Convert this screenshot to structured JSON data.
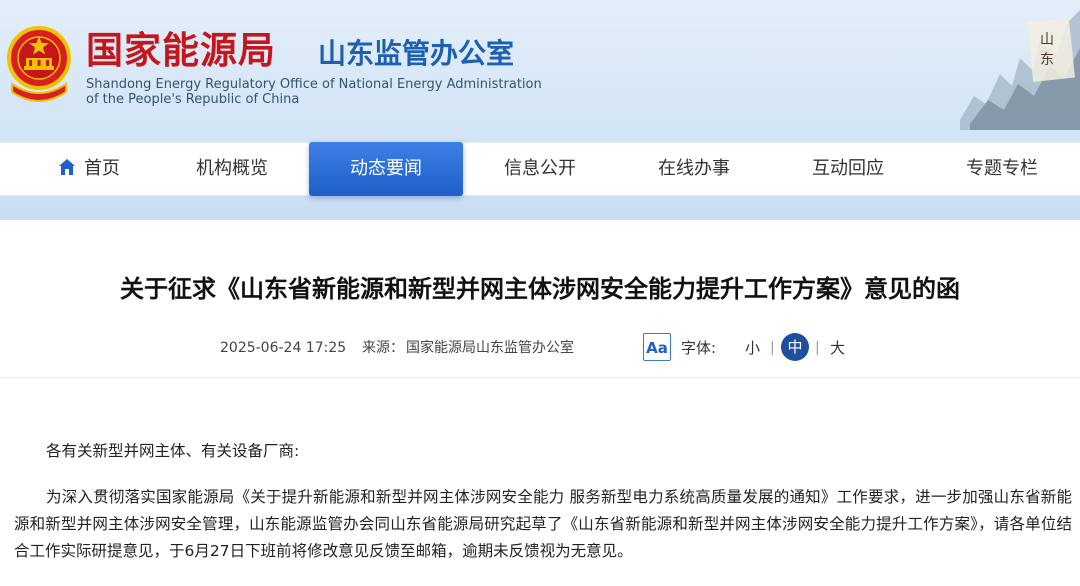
{
  "header": {
    "org_name_cn": "国家能源局",
    "office_name_cn": "山东监管办公室",
    "org_name_en_line1": "Shandong Energy Regulatory Office of National Energy Administration",
    "org_name_en_line2": "of the People's Republic of China"
  },
  "nav": {
    "items": [
      {
        "label": "首页",
        "icon": "home-icon"
      },
      {
        "label": "机构概览"
      },
      {
        "label": "动态要闻",
        "active": true
      },
      {
        "label": "信息公开"
      },
      {
        "label": "在线办事"
      },
      {
        "label": "互动回应"
      },
      {
        "label": "专题专栏"
      }
    ]
  },
  "article": {
    "title": "关于征求《山东省新能源和新型并网主体涉网安全能力提升工作方案》意见的函",
    "date": "2025-06-24 17:25",
    "source_label": "来源：",
    "source": "国家能源局山东监管办公室",
    "font_icon_text": "Aa",
    "font_label": "字体:",
    "font_sizes": [
      "小",
      "中",
      "大"
    ],
    "font_size_selected": "中",
    "font_sep": "|",
    "greeting": "各有关新型并网主体、有关设备厂商:",
    "body": "为深入贯彻落实国家能源局《关于提升新能源和新型并网主体涉网安全能力  服务新型电力系统高质量发展的通知》工作要求，进一步加强山东省新能源和新型并网主体涉网安全管理，山东能源监管办会同山东省能源局研究起草了《山东省新能源和新型并网主体涉网安全能力提升工作方案》，请各单位结合工作实际研提意见，于6月27日下班前将修改意见反馈至邮箱，逾期未反馈视为无意见。"
  },
  "colors": {
    "brand_red": "#c4171d",
    "brand_blue": "#1d5fb0",
    "nav_active": "#1f5fc8",
    "header_bg": "#d4e5f6"
  }
}
